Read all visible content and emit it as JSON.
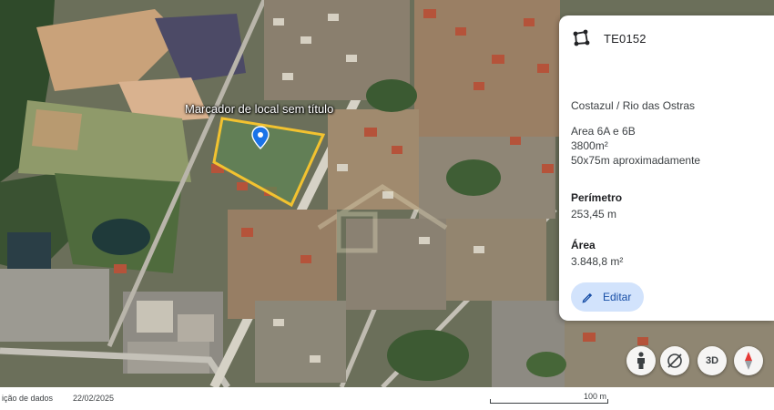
{
  "map": {
    "place_label": "Marcador de local sem título",
    "marker_color": "#1a73e8",
    "polygon_color": "#f2c230"
  },
  "panel": {
    "title": "TE0152",
    "location": "Costazul / Rio das Ostras",
    "description_lines": [
      "Area 6A e 6B",
      "3800m²",
      "50x75m aproximadamente"
    ],
    "perimeter_label": "Perímetro",
    "perimeter_value": "253,45 m",
    "area_label": "Área",
    "area_value": "3.848,8 m²",
    "edit_label": "Editar"
  },
  "controls": {
    "three_d_label": "3D"
  },
  "footer": {
    "attribution_link": "ição de dados",
    "date": "22/02/2025",
    "scale_label": "100 m"
  }
}
